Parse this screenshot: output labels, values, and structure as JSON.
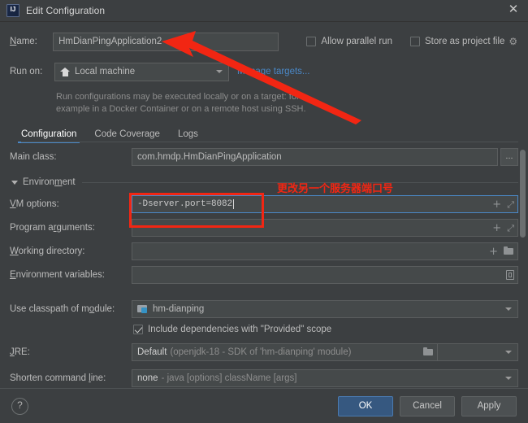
{
  "window": {
    "title": "Edit Configuration",
    "logo_icon": "intellij-idea-icon",
    "close_icon": "✕"
  },
  "header": {
    "name_label": "Name:",
    "name_value": "HmDianPingApplication2",
    "allow_parallel_run_label": "Allow parallel run",
    "allow_parallel_run_checked": false,
    "store_as_project_file_label": "Store as project file",
    "store_as_project_file_checked": false,
    "gear_icon": "✿",
    "run_on_label": "Run on:",
    "run_on_value": "Local machine",
    "run_on_icon": "home-icon",
    "manage_targets_link": "Manage targets...",
    "hint_line1": "Run configurations may be executed locally or on a target: for",
    "hint_line2": "example in a Docker Container or on a remote host using SSH."
  },
  "tabs": [
    {
      "label": "Configuration",
      "active": true
    },
    {
      "label": "Code Coverage",
      "active": false
    },
    {
      "label": "Logs",
      "active": false
    }
  ],
  "form": {
    "main_class": {
      "label": "Main class:",
      "value": "com.hmdp.HmDianPingApplication",
      "browse_button": "..."
    },
    "environment": {
      "section_label": "Environment",
      "expanded": true,
      "collapse_icon": "triangle-down-icon"
    },
    "vm_options": {
      "label": "VM options:",
      "value": "-Dserver.port=8082",
      "expand_icon": "⤢",
      "add_icon": "+"
    },
    "program_arguments": {
      "label": "Program arguments:",
      "value": "",
      "expand_icon": "⤢",
      "add_icon": "+"
    },
    "working_directory": {
      "label": "Working directory:",
      "value": "",
      "add_icon": "+",
      "browse_icon": "folder-icon"
    },
    "environment_variables": {
      "label": "Environment variables:",
      "value": "",
      "browse_icon": "document-icon"
    },
    "use_classpath_of_module": {
      "label": "Use classpath of module:",
      "value": "hm-dianping",
      "module_icon": "module-icon"
    },
    "include_dependencies": {
      "label": "Include dependencies with \"Provided\" scope",
      "checked": true
    },
    "jre": {
      "label": "JRE:",
      "value_strong": "Default",
      "value_dim": "(openjdk-18 - SDK of 'hm-dianping' module)",
      "browse_icon": "folder-icon"
    },
    "shorten_command_line": {
      "label": "Shorten command line:",
      "value_strong": "none",
      "value_dim": "- java [options] className [args]"
    }
  },
  "footer": {
    "help_label": "?",
    "ok_label": "OK",
    "cancel_label": "Cancel",
    "apply_label": "Apply"
  },
  "annotations": {
    "note_text": "更改另一个服务器端口号",
    "accent_color": "#f22613",
    "arrow_target": "name-input",
    "box_target": "vm-options-field"
  },
  "colors": {
    "window_bg": "#3c3f41",
    "field_bg": "#45494a",
    "accent_blue": "#4a88c7",
    "primary_button": "#365880",
    "annotation_red": "#f22613"
  }
}
